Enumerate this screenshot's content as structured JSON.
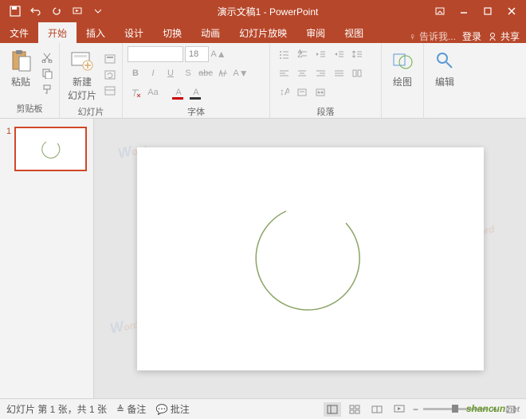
{
  "window": {
    "title": "演示文稿1 - PowerPoint"
  },
  "tabs": {
    "file": "文件",
    "home": "开始",
    "insert": "插入",
    "design": "设计",
    "transitions": "切换",
    "animations": "动画",
    "slideshow": "幻灯片放映",
    "review": "审阅",
    "view": "视图",
    "tell": "告诉我...",
    "login": "登录",
    "share": "共享"
  },
  "ribbon": {
    "paste": "粘贴",
    "clipboard": "剪贴板",
    "newslide": "新建\n幻灯片",
    "slides": "幻灯片",
    "fontsize": "18",
    "font": "字体",
    "paragraph": "段落",
    "drawing": "绘图",
    "editing": "编辑"
  },
  "thumbs": {
    "n1": "1"
  },
  "status": {
    "slide": "幻灯片 第 1 张，共 1 张",
    "notes": "备注",
    "comments": "批注"
  },
  "watermark": {
    "brand": "shancun",
    "suffix": ".net"
  },
  "chart_data": null
}
